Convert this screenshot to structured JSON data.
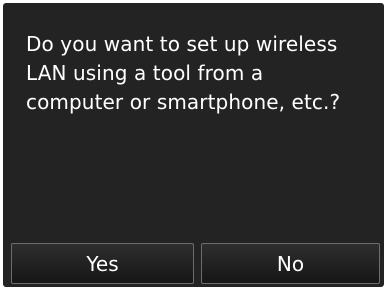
{
  "dialog": {
    "message": "Do you want to set up wireless\nLAN using a tool from a\ncomputer or smartphone, etc.?"
  },
  "buttons": {
    "yes_label": "Yes",
    "no_label": "No"
  },
  "colors": {
    "screen_background": "#232323",
    "text": "#ffffff",
    "button_border": "#6c6c6c"
  }
}
